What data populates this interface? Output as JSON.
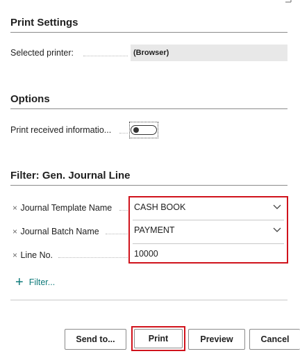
{
  "print_settings": {
    "title": "Print Settings",
    "selected_printer_label": "Selected printer:",
    "selected_printer_value": "(Browser)"
  },
  "options": {
    "title": "Options",
    "print_received_label": "Print received informatio...",
    "print_received_on": false
  },
  "filter": {
    "title": "Filter: Gen. Journal Line",
    "remove_glyph": "×",
    "rows": [
      {
        "label": "Journal Template Name",
        "value": "CASH BOOK"
      },
      {
        "label": "Journal Batch Name",
        "value": "PAYMENT"
      },
      {
        "label": "Line No.",
        "value": "10000"
      }
    ],
    "add_filter_glyph": "+",
    "add_filter_label": "Filter..."
  },
  "buttons": {
    "send_to": "Send to...",
    "print": "Print",
    "preview": "Preview",
    "cancel": "Cancel"
  },
  "colors": {
    "highlight_red": "#d0121b",
    "link_teal": "#0e7a7a"
  }
}
